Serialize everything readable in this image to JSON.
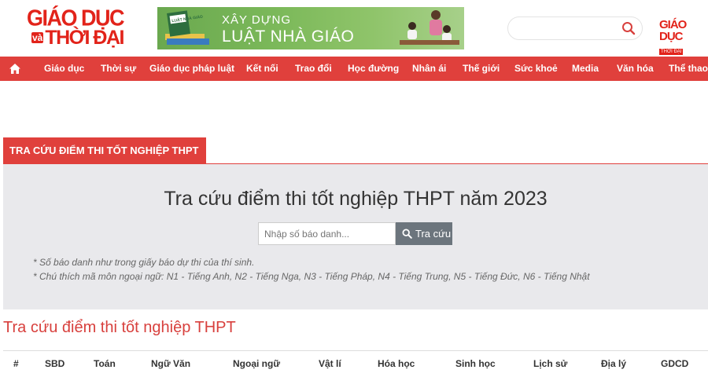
{
  "header": {
    "logo_line1": "GIÁO DỤC",
    "logo_va": "và",
    "logo_line2": "THỜI ĐẠI",
    "banner": {
      "line1": "XÂY DỰNG",
      "line2": "LUẬT NHÀ GIÁO",
      "book_text": "LUẬT NHÀ GIÁO"
    },
    "search_placeholder": "",
    "mini_logo_line1": "GIÁO DỤC",
    "mini_logo_line2": "THỜI ĐẠI"
  },
  "nav": {
    "items": [
      "Giáo dục",
      "Thời sự",
      "Giáo dục pháp luật",
      "Kết nối",
      "Trao đổi",
      "Học đường",
      "Nhân ái",
      "Thế giới",
      "Sức khoẻ",
      "Media",
      "Văn hóa",
      "Thể thao"
    ]
  },
  "panel": {
    "tab_title": "TRA CỨU ĐIỂM THI TỐT NGHIỆP THPT",
    "heading": "Tra cứu điểm thi tốt nghiệp THPT năm 2023",
    "input_placeholder": "Nhập số báo danh...",
    "button_label": "Tra cứu",
    "note1": "* Số báo danh như trong giấy báo dự thi của thí sinh.",
    "note2": "* Chú thích mã môn ngoại ngữ: N1 - Tiếng Anh, N2 - Tiếng Nga, N3 - Tiếng Pháp, N4 - Tiếng Trung, N5 - Tiếng Đức, N6 - Tiếng Nhật"
  },
  "results": {
    "title": "Tra cứu điểm thi tốt nghiệp THPT",
    "columns": [
      "#",
      "SBD",
      "Toán",
      "Ngữ Văn",
      "Ngoại ngữ",
      "Vật lí",
      "Hóa học",
      "Sinh học",
      "Lịch sử",
      "Địa lý",
      "GDCD"
    ]
  },
  "colors": {
    "brand_red": "#e0403c",
    "logo_red": "#e2231a",
    "panel_bg": "#e9e9ec",
    "button_gray": "#6c757d"
  },
  "icons": [
    "home-icon",
    "search-icon"
  ]
}
